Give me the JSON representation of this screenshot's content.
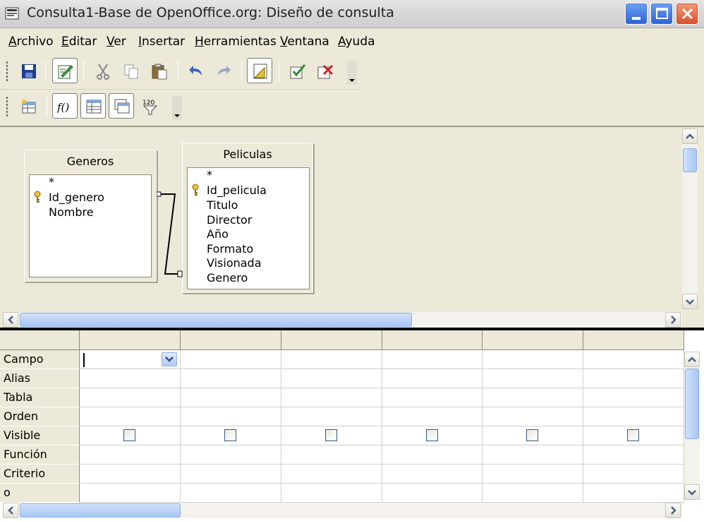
{
  "window": {
    "title": "Consulta1-Base de OpenOffice.org: Diseño de consulta"
  },
  "menu": [
    {
      "label": "Archivo",
      "ul": "A",
      "rest": "rchivo"
    },
    {
      "label": "Editar",
      "ul": "E",
      "rest": "ditar"
    },
    {
      "label": "Ver",
      "ul": "V",
      "rest": "er"
    },
    {
      "label": "Insertar",
      "ul": "I",
      "rest": "nsertar"
    },
    {
      "label": "Herramientas",
      "ul": "H",
      "rest": "erramientas"
    },
    {
      "label": "Ventana",
      "ul": "V",
      "rest": "entana"
    },
    {
      "label": "Ayuda",
      "ul": "A",
      "rest": "yuda"
    }
  ],
  "toolbar": {
    "function_label": "f()",
    "limit_label": "120"
  },
  "tables": [
    {
      "name": "Generos",
      "fields": [
        "*",
        "Id_genero",
        "Nombre"
      ],
      "key": "Id_genero"
    },
    {
      "name": "Peliculas",
      "fields": [
        "*",
        "Id_pelicula",
        "Titulo",
        "Director",
        "Año",
        "Formato",
        "Visionada",
        "Genero"
      ],
      "key": "Id_pelicula"
    }
  ],
  "grid": {
    "rows": [
      "Campo",
      "Alias",
      "Tabla",
      "Orden",
      "Visible",
      "Función",
      "Criterio",
      "o"
    ]
  },
  "colors": {
    "face": "#ece9d8",
    "accent": "#2a63d8",
    "close": "#d8522a"
  }
}
